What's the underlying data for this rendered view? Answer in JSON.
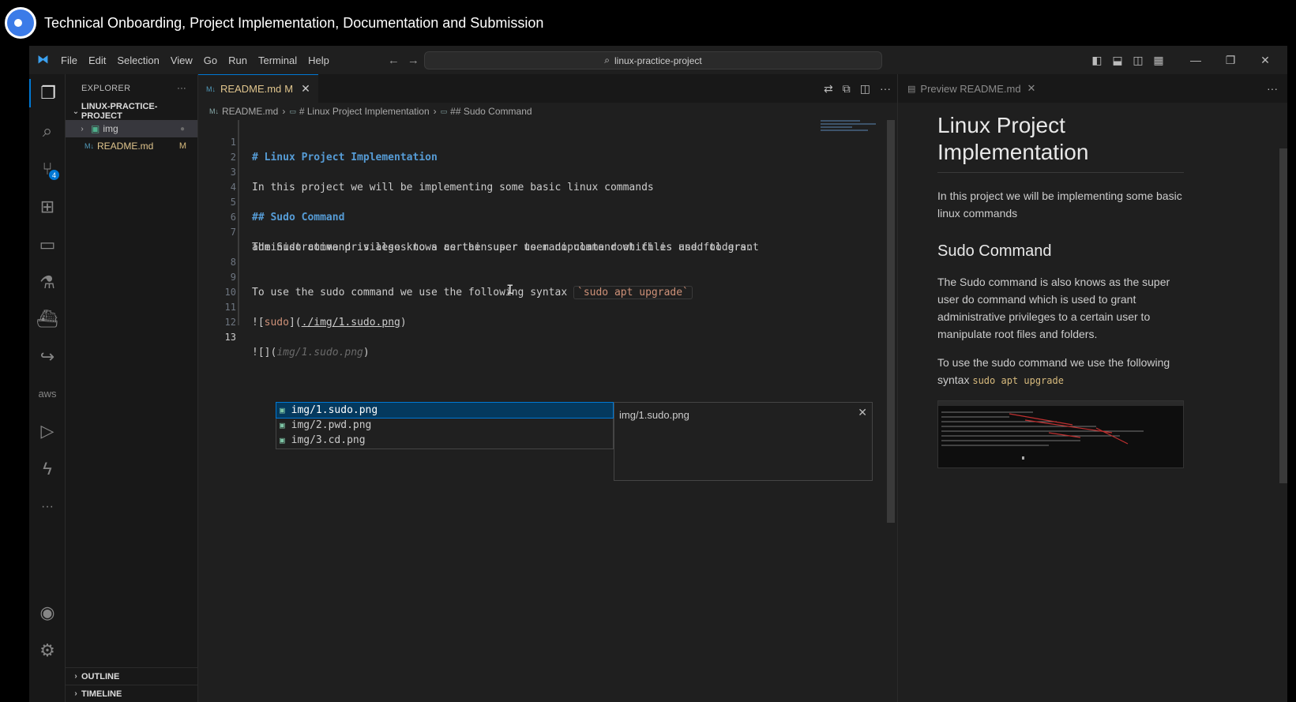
{
  "video": {
    "title": "Technical Onboarding, Project Implementation, Documentation and Submission"
  },
  "titlebar": {
    "menu": [
      "File",
      "Edit",
      "Selection",
      "View",
      "Go",
      "Run",
      "Terminal",
      "Help"
    ],
    "command_center": "linux-practice-project"
  },
  "activity_bar": {
    "icons": [
      "files-icon",
      "search-icon",
      "source-control-icon",
      "extensions-icon",
      "remote-explorer-icon",
      "testing-icon",
      "docker-icon",
      "live-share-icon",
      "aws-icon",
      "run-debug-icon",
      "thunder-client-icon",
      "more-icon",
      "account-icon",
      "settings-gear-icon"
    ],
    "source_control_badge": "4",
    "aws_label": "aws",
    "more_label": "···"
  },
  "explorer": {
    "header": "EXPLORER",
    "more": "···",
    "project": "LINUX-PRACTICE-PROJECT",
    "items": [
      {
        "label": "img",
        "type": "folder",
        "status": "●"
      },
      {
        "label": "README.md",
        "type": "file",
        "status": "M"
      }
    ],
    "outline": "OUTLINE",
    "timeline": "TIMELINE"
  },
  "editor": {
    "tab": {
      "label": "README.md",
      "status": "M"
    },
    "breadcrumb": [
      "README.md",
      "# Linux Project Implementation",
      "## Sudo Command"
    ],
    "lines": [
      {
        "n": "1",
        "text": "# Linux Project Implementation"
      },
      {
        "n": "2",
        "text": ""
      },
      {
        "n": "3",
        "text": "In this project we will be implementing some basic linux commands"
      },
      {
        "n": "4",
        "text": ""
      },
      {
        "n": "5",
        "text": "## Sudo Command"
      },
      {
        "n": "6",
        "text": ""
      },
      {
        "n": "7",
        "text": "The Sudo command is also knows as the super user do command which is used to grant"
      },
      {
        "n": "7b",
        "text": "administrative privileges to a certain user to manipulate root files and folders."
      },
      {
        "n": "8",
        "text": ""
      },
      {
        "n": "9",
        "text": "To use the sudo command we use the following syntax "
      },
      {
        "n": "10",
        "text": ""
      },
      {
        "n": "11",
        "text": "![sudo](./img/1.sudo.png)"
      },
      {
        "n": "12",
        "text": ""
      },
      {
        "n": "13",
        "text": "![]("
      }
    ],
    "line9_code": "`sudo apt upgrade`",
    "line11_alt": "sudo",
    "line11_url": "./img/1.sudo.png",
    "line13_ghost": "img/1.sudo.png",
    "line13_close": ")",
    "suggestions": [
      "img/1.sudo.png",
      "img/2.pwd.png",
      "img/3.cd.png"
    ],
    "suggestion_detail": "img/1.sudo.png"
  },
  "preview": {
    "tab": "Preview README.md",
    "h1": "Linux Project Implementation",
    "p1": "In this project we will be implementing some basic linux commands",
    "h2": "Sudo Command",
    "p2": "The Sudo command is also knows as the super user do command which is used to grant administrative privileges to a certain user to manipulate root files and folders.",
    "p3_text": "To use the sudo command we use the following syntax ",
    "p3_code": "sudo apt upgrade"
  },
  "colors": {
    "accent": "#0078d4",
    "heading": "#569cd6",
    "string": "#ce9178",
    "modified": "#d7ba7d"
  }
}
